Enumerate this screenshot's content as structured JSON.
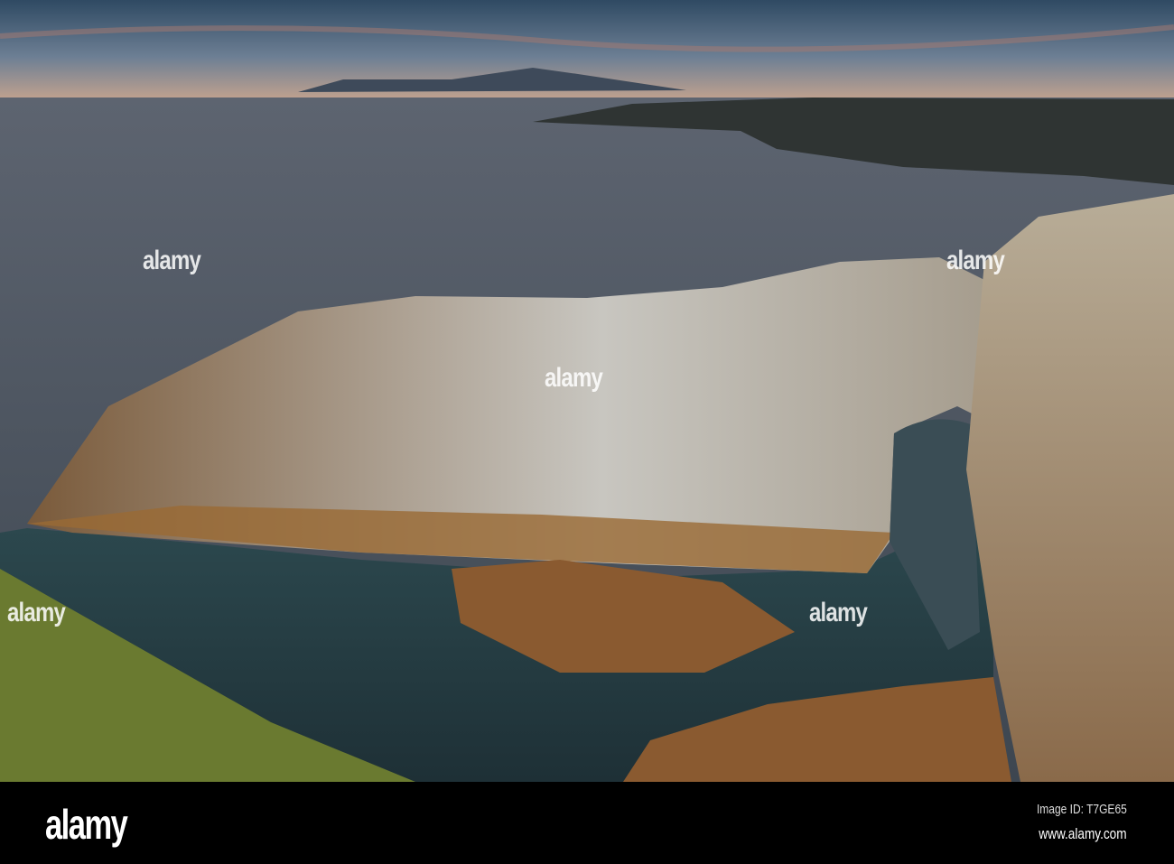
{
  "watermark": {
    "text": "alamy"
  },
  "footer": {
    "logo": "alamy",
    "image_id": "Image ID: T7GE65",
    "url": "www.alamy.com"
  }
}
